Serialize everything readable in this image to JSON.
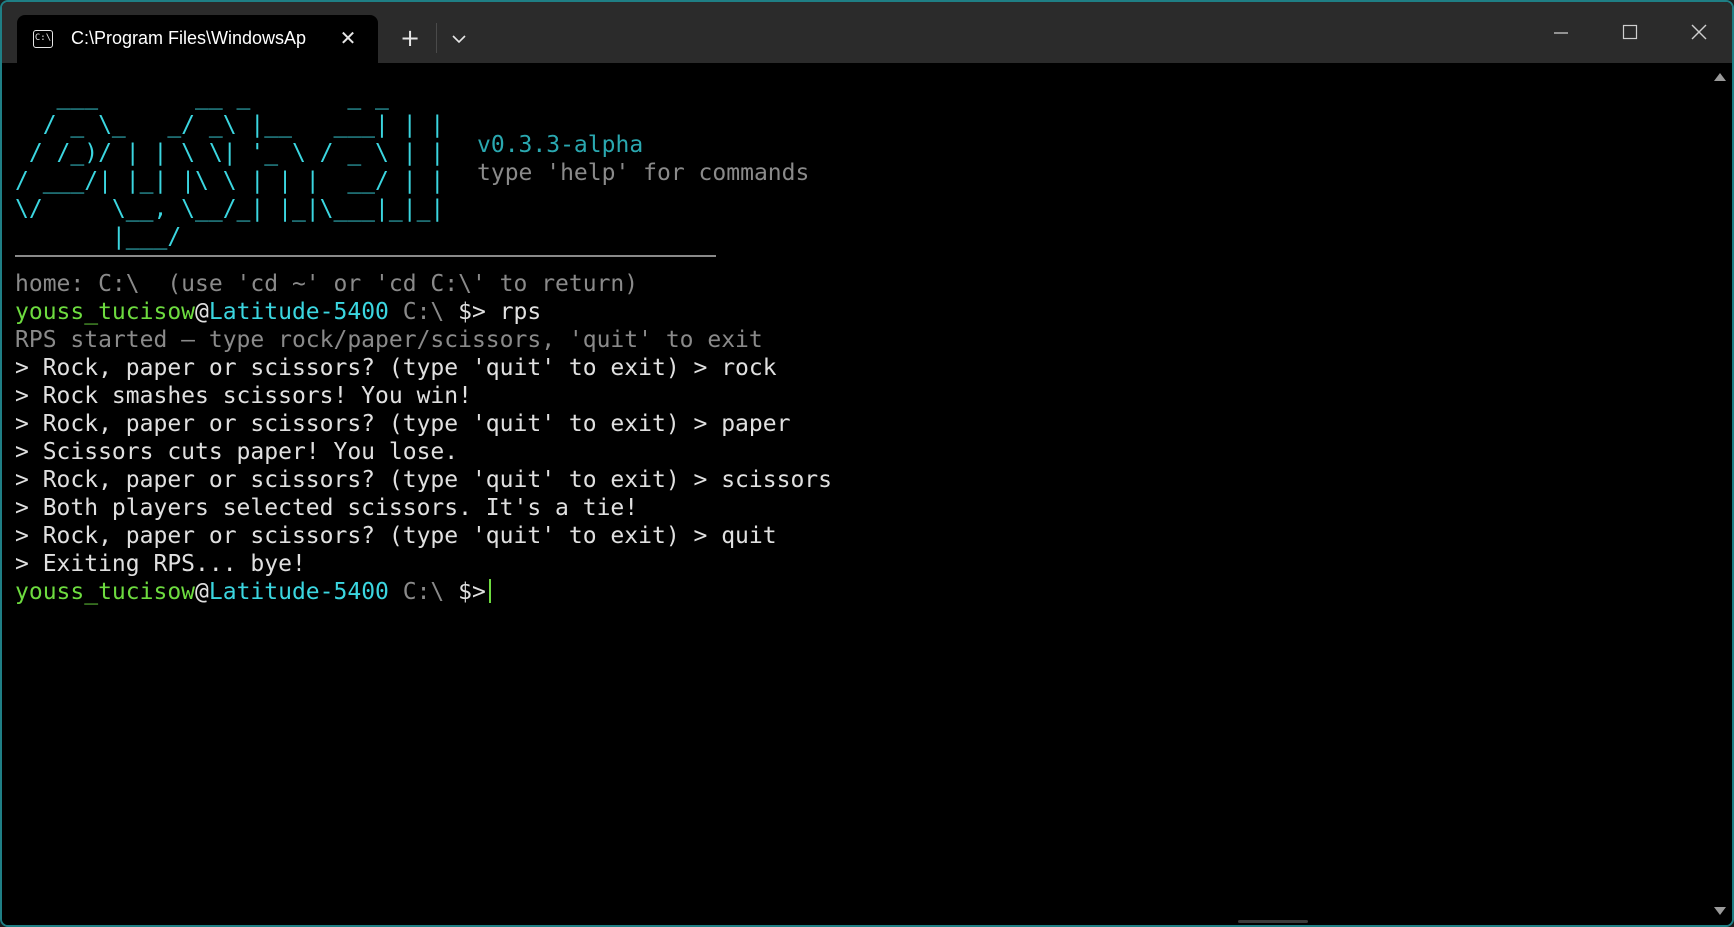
{
  "window": {
    "tab_title": "C:\\Program Files\\WindowsAp",
    "tab_icon": "terminal-icon",
    "accent_border": "#1f7f85"
  },
  "banner": {
    "ascii_art": "   ___       __ _       _ _\n  / _ \\_   _/ _\\ |__   ___| | |\n / /_)/ | | \\ \\| '_ \\ / _ \\ | |\n/ ___/| |_| |\\ \\ | | |  __/ | |\n\\/     \\__, \\__/_| |_|\\___|_|_|\n       |___/",
    "version": "v0.3.3-alpha",
    "help_hint": "type 'help' for commands"
  },
  "terminal": {
    "home_line": "home: C:\\  (use 'cd ~' or 'cd C:\\' to return)",
    "user": "youss_tucisow",
    "at": "@",
    "host": "Latitude-5400",
    "cwd": " C:\\ ",
    "prompt_symbol": "$>",
    "command1": " rps",
    "rps_started": "RPS started — type rock/paper/scissors, 'quit' to exit",
    "output_lines": [
      "> Rock, paper or scissors? (type 'quit' to exit) > rock",
      "> Rock smashes scissors! You win!",
      "> Rock, paper or scissors? (type 'quit' to exit) > paper",
      "> Scissors cuts paper! You lose.",
      "> Rock, paper or scissors? (type 'quit' to exit) > scissors",
      "> Both players selected scissors. It's a tie!",
      "> Rock, paper or scissors? (type 'quit' to exit) > quit",
      "> Exiting RPS... bye!"
    ]
  },
  "colors": {
    "user_green": "#6ddb3f",
    "host_cyan": "#3bd6e0",
    "muted_gray": "#8a8a8a",
    "version_teal": "#2aa8b0"
  }
}
